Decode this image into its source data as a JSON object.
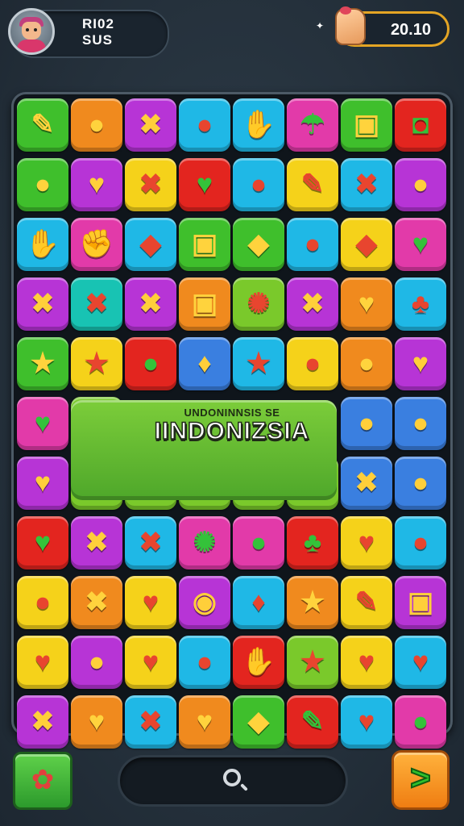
{
  "profile": {
    "line1": "RI02",
    "line2": "SUS",
    "avatar_icon": "avatar-icon"
  },
  "currency": {
    "value": "20.10",
    "icon": "fist-icon"
  },
  "banner": {
    "subtitle": "UNDONINNSIS SE",
    "title": "IINDONIZSIA"
  },
  "colors": {
    "G": "#3fbf2c",
    "O": "#f08a1e",
    "P": "#b734d6",
    "C": "#1fb8e6",
    "M": "#e23aa9",
    "Y": "#f5d21a",
    "R": "#e3251f",
    "L": "#7ac92b",
    "B": "#3a7fe0",
    "T": "#18c3b3"
  },
  "board": {
    "rows": [
      [
        {
          "c": "G",
          "i": "✎",
          "n": "pencil-icon"
        },
        {
          "c": "O",
          "i": "●",
          "n": "cookie-icon"
        },
        {
          "c": "P",
          "i": "✖",
          "n": "cross-icon"
        },
        {
          "c": "C",
          "i": "●",
          "n": "balloon-icon"
        },
        {
          "c": "C",
          "i": "✋",
          "n": "hand-icon"
        },
        {
          "c": "M",
          "i": "☂",
          "n": "mushroom-icon"
        },
        {
          "c": "G",
          "i": "▣",
          "n": "camera-icon"
        },
        {
          "c": "R",
          "i": "◘",
          "n": "box-icon"
        }
      ],
      [
        {
          "c": "G",
          "i": "●",
          "n": "lollipop-icon"
        },
        {
          "c": "P",
          "i": "♥",
          "n": "heart-icon"
        },
        {
          "c": "Y",
          "i": "✖",
          "n": "cross-icon"
        },
        {
          "c": "R",
          "i": "♥",
          "n": "heart-icon"
        },
        {
          "c": "C",
          "i": "●",
          "n": "lollipop-icon"
        },
        {
          "c": "Y",
          "i": "✎",
          "n": "pen-icon"
        },
        {
          "c": "C",
          "i": "✖",
          "n": "cross-icon"
        },
        {
          "c": "P",
          "i": "●",
          "n": "lollipop-icon"
        }
      ],
      [
        {
          "c": "C",
          "i": "✋",
          "n": "hand-icon"
        },
        {
          "c": "M",
          "i": "✊",
          "n": "fist-icon"
        },
        {
          "c": "C",
          "i": "◆",
          "n": "cube-icon"
        },
        {
          "c": "G",
          "i": "▣",
          "n": "robot-icon"
        },
        {
          "c": "G",
          "i": "◆",
          "n": "gem-icon"
        },
        {
          "c": "C",
          "i": "●",
          "n": "creature-icon"
        },
        {
          "c": "Y",
          "i": "◆",
          "n": "crystal-icon"
        },
        {
          "c": "M",
          "i": "♥",
          "n": "heart-icon"
        }
      ],
      [
        {
          "c": "P",
          "i": "✖",
          "n": "cross-icon"
        },
        {
          "c": "T",
          "i": "✖",
          "n": "cross-icon"
        },
        {
          "c": "P",
          "i": "✖",
          "n": "cross-icon"
        },
        {
          "c": "O",
          "i": "▣",
          "n": "face-icon"
        },
        {
          "c": "L",
          "i": "✺",
          "n": "gear-icon"
        },
        {
          "c": "P",
          "i": "✖",
          "n": "cross-icon"
        },
        {
          "c": "O",
          "i": "♥",
          "n": "apple-icon"
        },
        {
          "c": "C",
          "i": "♣",
          "n": "clover-icon"
        }
      ],
      [
        {
          "c": "G",
          "i": "★",
          "n": "star-icon"
        },
        {
          "c": "Y",
          "i": "★",
          "n": "star-icon"
        },
        {
          "c": "R",
          "i": "●",
          "n": "balloon-icon"
        },
        {
          "c": "B",
          "i": "♦",
          "n": "ribbon-icon"
        },
        {
          "c": "C",
          "i": "★",
          "n": "star-icon"
        },
        {
          "c": "Y",
          "i": "●",
          "n": "lollipop-icon"
        },
        {
          "c": "O",
          "i": "●",
          "n": "bear-icon"
        },
        {
          "c": "P",
          "i": "♥",
          "n": "heart-icon"
        }
      ],
      [
        {
          "c": "M",
          "i": "♥",
          "n": "heart-icon"
        },
        {
          "c": "L",
          "i": "●",
          "n": "balloon-icon"
        },
        null,
        null,
        null,
        null,
        {
          "c": "B",
          "i": "●",
          "n": "ring-icon"
        },
        {
          "c": "B",
          "i": "●",
          "n": "balloon-icon"
        }
      ],
      [
        {
          "c": "P",
          "i": "♥",
          "n": "heart-icon"
        },
        {
          "c": "L",
          "i": "●",
          "n": "ball-icon"
        },
        {
          "c": "L",
          "i": "●",
          "n": "cookie-icon"
        },
        {
          "c": "L",
          "i": "✎",
          "n": "carrot-icon"
        },
        {
          "c": "L",
          "i": "♥",
          "n": "heart-icon"
        },
        {
          "c": "L",
          "i": "✎",
          "n": "battery-icon"
        },
        {
          "c": "B",
          "i": "✖",
          "n": "ribbon-icon"
        },
        {
          "c": "B",
          "i": "●",
          "n": "ring-icon"
        }
      ],
      [
        {
          "c": "R",
          "i": "♥",
          "n": "apple-icon"
        },
        {
          "c": "P",
          "i": "✖",
          "n": "cross-icon"
        },
        {
          "c": "C",
          "i": "✖",
          "n": "cross-icon"
        },
        {
          "c": "M",
          "i": "✺",
          "n": "gear-icon"
        },
        {
          "c": "M",
          "i": "●",
          "n": "balloon-icon"
        },
        {
          "c": "R",
          "i": "♣",
          "n": "grass-icon"
        },
        {
          "c": "Y",
          "i": "♥",
          "n": "apple-icon"
        },
        {
          "c": "C",
          "i": "●",
          "n": "balloon-icon"
        }
      ],
      [
        {
          "c": "Y",
          "i": "●",
          "n": "balloon-icon"
        },
        {
          "c": "O",
          "i": "✖",
          "n": "cross-icon"
        },
        {
          "c": "Y",
          "i": "♥",
          "n": "heart-icon"
        },
        {
          "c": "P",
          "i": "◉",
          "n": "swirl-icon"
        },
        {
          "c": "C",
          "i": "♦",
          "n": "gem-icon"
        },
        {
          "c": "O",
          "i": "★",
          "n": "star-icon"
        },
        {
          "c": "Y",
          "i": "✎",
          "n": "pen-icon"
        },
        {
          "c": "P",
          "i": "▣",
          "n": "camera-icon"
        }
      ],
      [
        {
          "c": "Y",
          "i": "♥",
          "n": "heart-icon"
        },
        {
          "c": "P",
          "i": "●",
          "n": "balloon-icon"
        },
        {
          "c": "Y",
          "i": "♥",
          "n": "apple-icon"
        },
        {
          "c": "C",
          "i": "●",
          "n": "balloon-icon"
        },
        {
          "c": "R",
          "i": "✋",
          "n": "hand-icon"
        },
        {
          "c": "L",
          "i": "★",
          "n": "star-icon"
        },
        {
          "c": "Y",
          "i": "♥",
          "n": "heart-icon"
        },
        {
          "c": "C",
          "i": "♥",
          "n": "apple-icon"
        }
      ],
      [
        {
          "c": "P",
          "i": "✖",
          "n": "cross-icon"
        },
        {
          "c": "O",
          "i": "♥",
          "n": "heart-icon"
        },
        {
          "c": "C",
          "i": "✖",
          "n": "cross-icon"
        },
        {
          "c": "O",
          "i": "♥",
          "n": "apple-icon"
        },
        {
          "c": "G",
          "i": "◆",
          "n": "gem-icon"
        },
        {
          "c": "R",
          "i": "✎",
          "n": "pencil-icon"
        },
        {
          "c": "C",
          "i": "♥",
          "n": "heart-icon"
        },
        {
          "c": "M",
          "i": "●",
          "n": "ring-icon"
        }
      ]
    ]
  },
  "bottom": {
    "shop_icon": "gift-icon",
    "next_icon": "arrow-right-icon",
    "search_icon": "search-icon"
  }
}
